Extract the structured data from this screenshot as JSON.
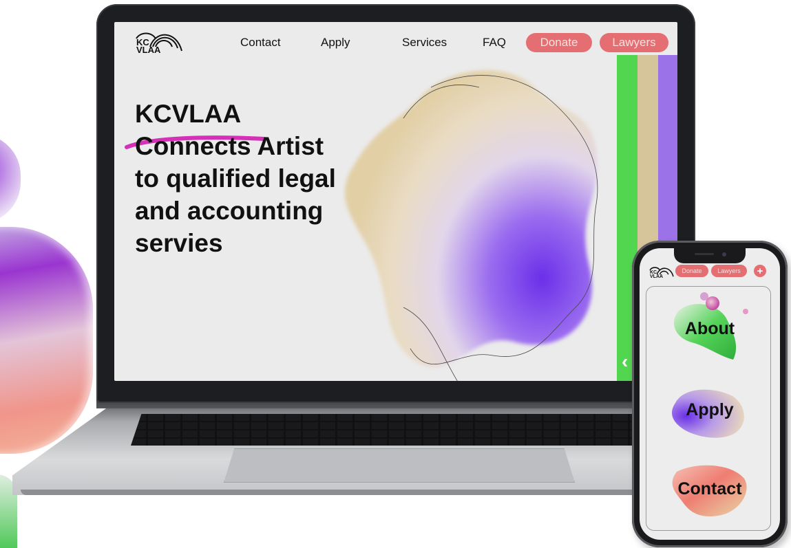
{
  "colors": {
    "accent_pink": "#e46e72",
    "stripe_green": "#52d64f",
    "stripe_tan": "#d6c49a",
    "stripe_purple": "#9c72e8",
    "underline_magenta": "#d431b8",
    "purple": "#7a3ce6"
  },
  "desktop": {
    "logo": {
      "line1": "KC",
      "line2": "VLAA"
    },
    "nav": {
      "contact": "Contact",
      "apply": "Apply",
      "services": "Services",
      "faq": "FAQ",
      "donate": "Donate",
      "lawyers": "Lawyers"
    },
    "hero": {
      "line1": "KCVLAA",
      "line2_highlight": "Connects",
      "line2_rest": " Artist",
      "line3": "to qualified legal",
      "line4": "and accounting",
      "line5": "servies"
    },
    "prev_arrow_icon": "chevron-left-icon",
    "prev_arrow_glyph": "‹"
  },
  "mobile": {
    "logo": {
      "line1": "KC",
      "line2": "VLAA"
    },
    "donate": "Donate",
    "lawyers": "Lawyers",
    "menu_icon": "plus-icon",
    "menu_glyph": "+",
    "cards": {
      "about": "About",
      "apply": "Apply",
      "contact": "Contact"
    }
  }
}
